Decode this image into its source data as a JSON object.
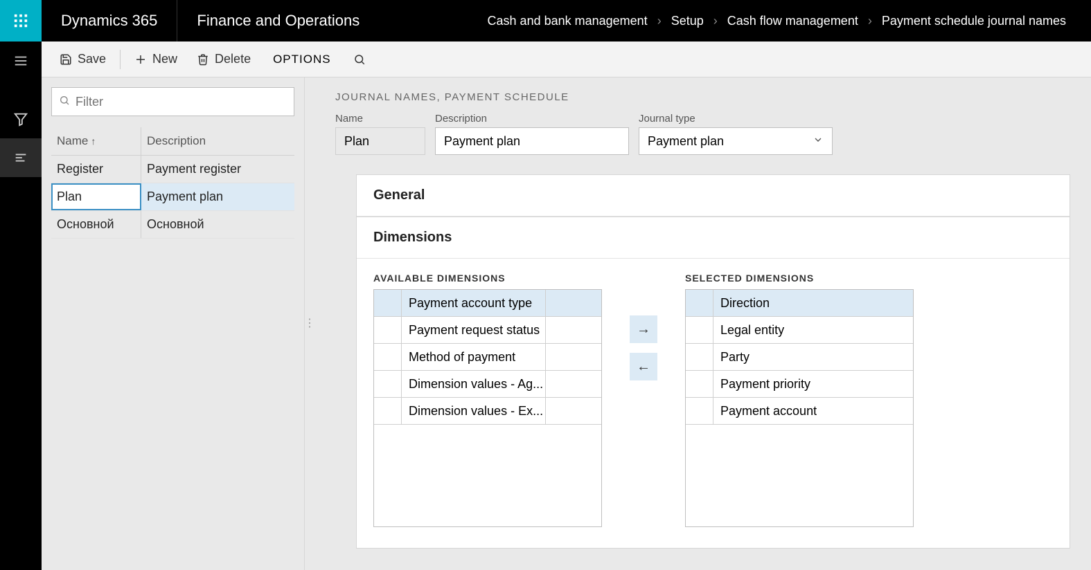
{
  "topbar": {
    "brand": "Dynamics 365",
    "app_title": "Finance and Operations",
    "breadcrumb": [
      "Cash and bank management",
      "Setup",
      "Cash flow management",
      "Payment schedule journal names"
    ]
  },
  "actions": {
    "save": "Save",
    "new": "New",
    "delete": "Delete",
    "options": "OPTIONS"
  },
  "filter": {
    "placeholder": "Filter"
  },
  "grid": {
    "cols": {
      "name": "Name",
      "desc": "Description"
    },
    "rows": [
      {
        "name": "Register",
        "desc": "Payment register",
        "selected": false
      },
      {
        "name": "Plan",
        "desc": "Payment plan",
        "selected": true
      },
      {
        "name": "Основной",
        "desc": "Основной",
        "selected": false
      }
    ]
  },
  "detail": {
    "page_title": "JOURNAL NAMES, PAYMENT SCHEDULE",
    "fields": {
      "name_label": "Name",
      "name_value": "Plan",
      "desc_label": "Description",
      "desc_value": "Payment plan",
      "type_label": "Journal type",
      "type_value": "Payment plan"
    },
    "general_title": "General",
    "dimensions_title": "Dimensions",
    "avail_title": "AVAILABLE DIMENSIONS",
    "sel_title": "SELECTED DIMENSIONS",
    "available": [
      "Payment account type",
      "Payment request status",
      "Method of payment",
      "Dimension values - Ag...",
      "Dimension values - Ex..."
    ],
    "selected": [
      "Direction",
      "Legal entity",
      "Party",
      "Payment priority",
      "Payment account"
    ]
  }
}
